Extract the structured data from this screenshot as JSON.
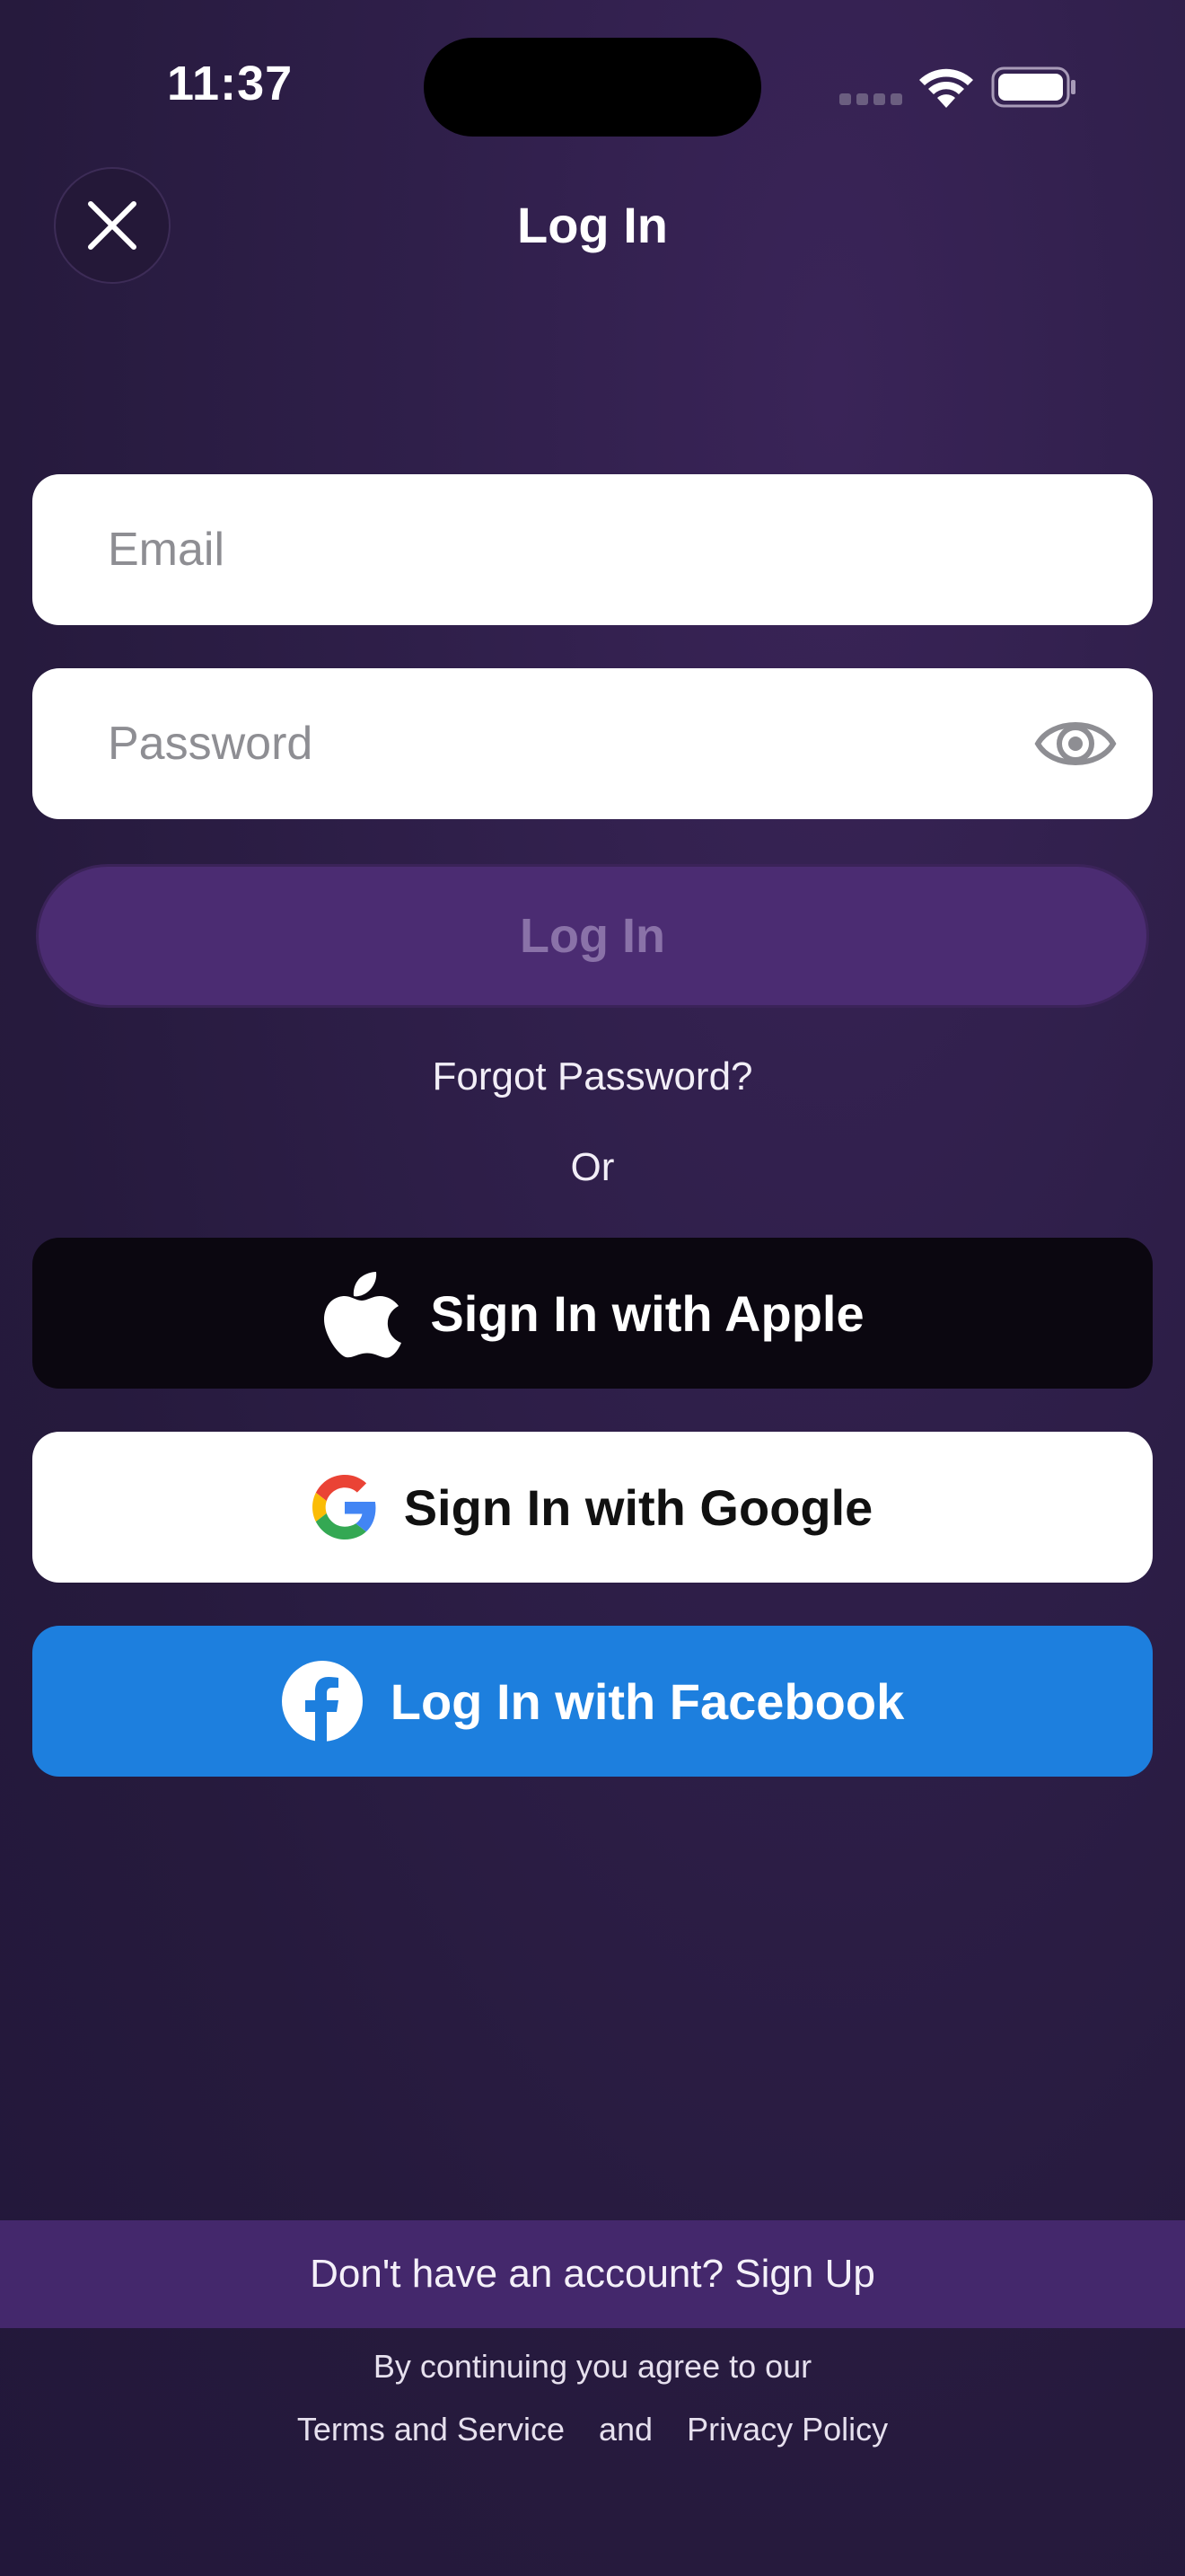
{
  "status_bar": {
    "time": "11:37"
  },
  "header": {
    "title": "Log In",
    "close_icon": "close-icon"
  },
  "form": {
    "email_placeholder": "Email",
    "email_value": "",
    "password_placeholder": "Password",
    "password_value": "",
    "login_label": "Log In",
    "forgot_label": "Forgot Password?",
    "or_label": "Or"
  },
  "social": {
    "apple_label": "Sign In with Apple",
    "google_label": "Sign In with Google",
    "facebook_label": "Log In with Facebook"
  },
  "footer": {
    "signup_text": "Don't have an account? Sign Up",
    "legal_intro": "By continuing you agree to our",
    "terms_label": "Terms and Service",
    "and_label": "and",
    "privacy_label": "Privacy Policy"
  },
  "colors": {
    "background": "#2a1c42",
    "primary_button": "#4b2c72",
    "primary_button_text": "#8a72a8",
    "apple": "#0b0710",
    "google": "#ffffff",
    "facebook": "#1d7fde",
    "signup_bar": "#44286c"
  }
}
